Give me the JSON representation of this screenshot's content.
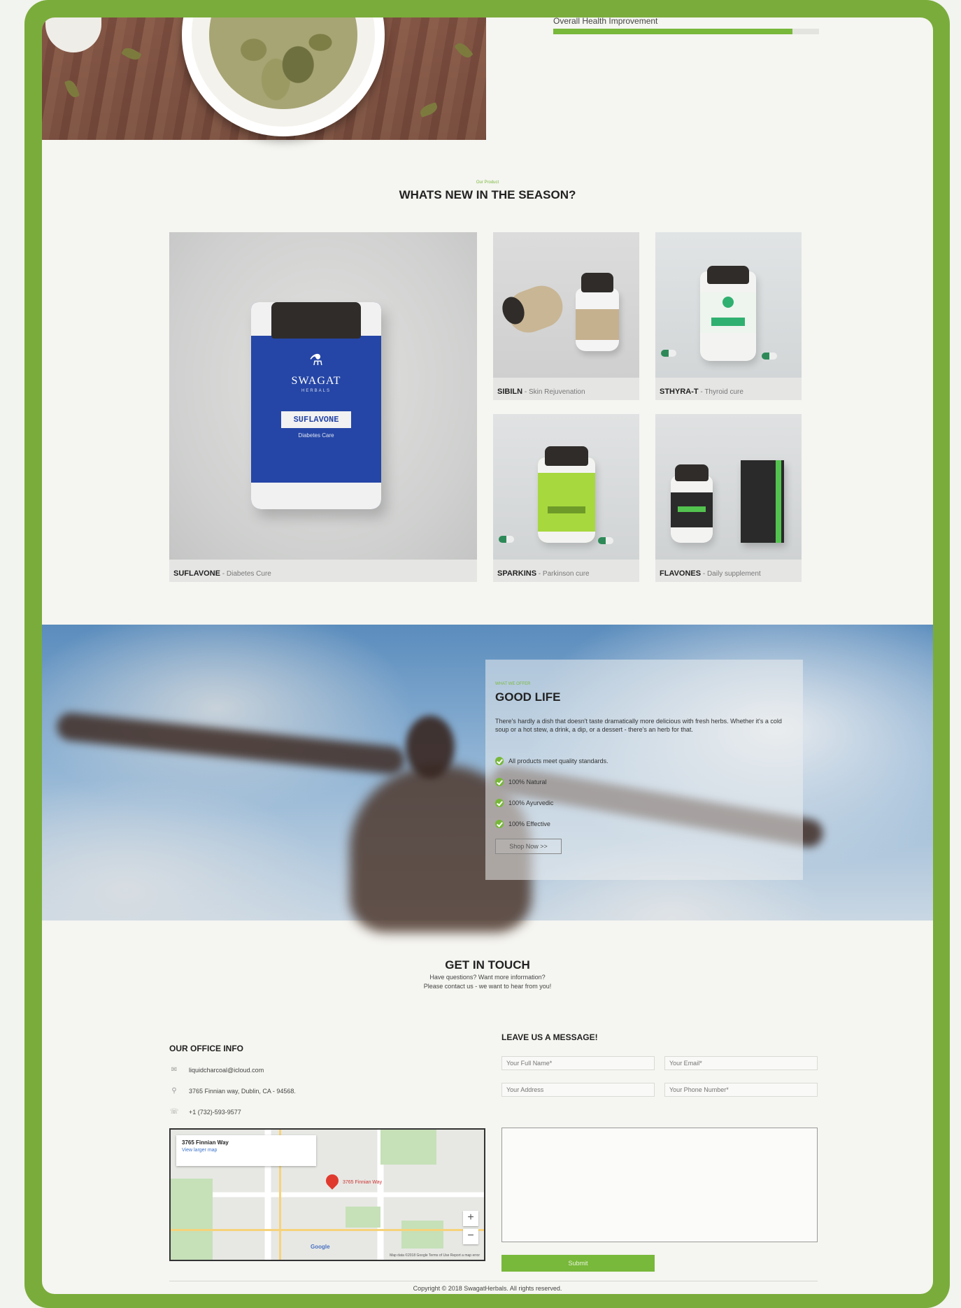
{
  "colors": {
    "frame": "#7aac3b",
    "accent": "#78b83a",
    "page_bg": "#f5f5f1"
  },
  "top": {
    "progress_label": "Overall Health Improvement",
    "progress_fraction": 0.9
  },
  "products_section": {
    "kicker": "Our Product",
    "title": "WHATS NEW IN THE SEASON?",
    "items": [
      {
        "name": "SUFLAVONE",
        "desc": " - Diabetes Cure",
        "label_text": "SUFLAVONE",
        "label_sub": "Diabetes Care",
        "brand": "SWAGAT",
        "brand_sub": "HERBALS"
      },
      {
        "name": "SIBILN",
        "desc": " - Skin Rejuvenation"
      },
      {
        "name": "STHYRA-T",
        "desc": " - Thyroid cure"
      },
      {
        "name": "SPARKINS",
        "desc": " - Parkinson cure"
      },
      {
        "name": "FLAVONES",
        "desc": " - Daily supplement"
      }
    ]
  },
  "good_life": {
    "kicker": "WHAT WE OFFER",
    "title": "GOOD LIFE",
    "text": "There's hardly a dish that doesn't taste dramatically more delicious with fresh herbs. Whether it's a cold soup or a hot stew, a drink, a dip, or a dessert - there's an herb for that.",
    "features": [
      "All products meet quality standards.",
      "100% Natural",
      "100% Ayurvedic",
      "100% Effective"
    ],
    "button": "Shop Now >>"
  },
  "contact": {
    "title": "GET IN TOUCH",
    "subtitle_1": "Have questions? Want more information?",
    "subtitle_2": "Please contact us - we want to hear from you!",
    "office_title": "OUR OFFICE INFO",
    "email": "liquidcharcoal@icloud.com",
    "address": "3765 Finnian way, Dublin, CA - 94568.",
    "phone": "+1 (732)-593-9577",
    "icons": {
      "email": "mail-icon",
      "address": "map-pin-icon",
      "phone": "phone-icon"
    },
    "map": {
      "place_name": "3765 Finnian Way",
      "view_larger": "View larger map",
      "pin_label": "3765 Finnian Way",
      "google": "Google",
      "terms": "Map data ©2018 Google  Terms of Use  Report a map error"
    },
    "message_title": "LEAVE US A MESSAGE!",
    "placeholders": {
      "name": "Your Full Name*",
      "email": "Your Email*",
      "address": "Your Address",
      "phone": "Your Phone Number*"
    },
    "submit": "Submit"
  },
  "footer": {
    "copyright": "Copyright © 2018 SwagatHerbals. All rights reserved."
  }
}
